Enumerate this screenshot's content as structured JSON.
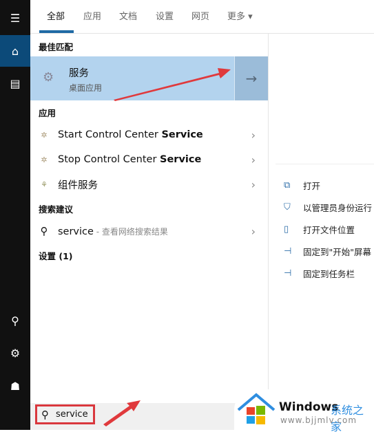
{
  "sidebar": {
    "items": [
      {
        "icon": "hamburger-icon"
      },
      {
        "icon": "home-icon",
        "selected": true
      },
      {
        "icon": "notebook-icon"
      },
      {
        "icon": "add-user-icon"
      },
      {
        "icon": "gear-icon"
      },
      {
        "icon": "feedback-icon"
      }
    ]
  },
  "tabs": [
    {
      "label": "全部",
      "active": true
    },
    {
      "label": "应用"
    },
    {
      "label": "文档"
    },
    {
      "label": "设置"
    },
    {
      "label": "网页"
    },
    {
      "label": "更多 ▾"
    }
  ],
  "best_match": {
    "header": "最佳匹配",
    "title": "服务",
    "subtitle": "桌面应用"
  },
  "apps": {
    "header": "应用",
    "items": [
      {
        "prefix": "Start Control Center ",
        "bold": "Service"
      },
      {
        "prefix": "Stop Control Center ",
        "bold": "Service"
      },
      {
        "prefix": "组件服务",
        "bold": ""
      }
    ]
  },
  "suggestions": {
    "header": "搜索建议",
    "query": "service",
    "hint": " - 查看网络搜索结果"
  },
  "settings": {
    "header": "设置 (1)"
  },
  "actions": [
    {
      "label": "打开",
      "icon": "open-icon"
    },
    {
      "label": "以管理员身份运行",
      "icon": "shield-icon"
    },
    {
      "label": "打开文件位置",
      "icon": "file-location-icon"
    },
    {
      "label": "固定到\"开始\"屏幕",
      "icon": "pin-icon"
    },
    {
      "label": "固定到任务栏",
      "icon": "pin-icon"
    }
  ],
  "search": {
    "value": "service"
  },
  "watermark": {
    "brand": "Windows",
    "cn": "系统之家",
    "url": "www.bjjmlv.com"
  },
  "colors": {
    "accent": "#1f6aa5",
    "highlight": "#b3d3ee",
    "annotation": "#d9373d"
  }
}
